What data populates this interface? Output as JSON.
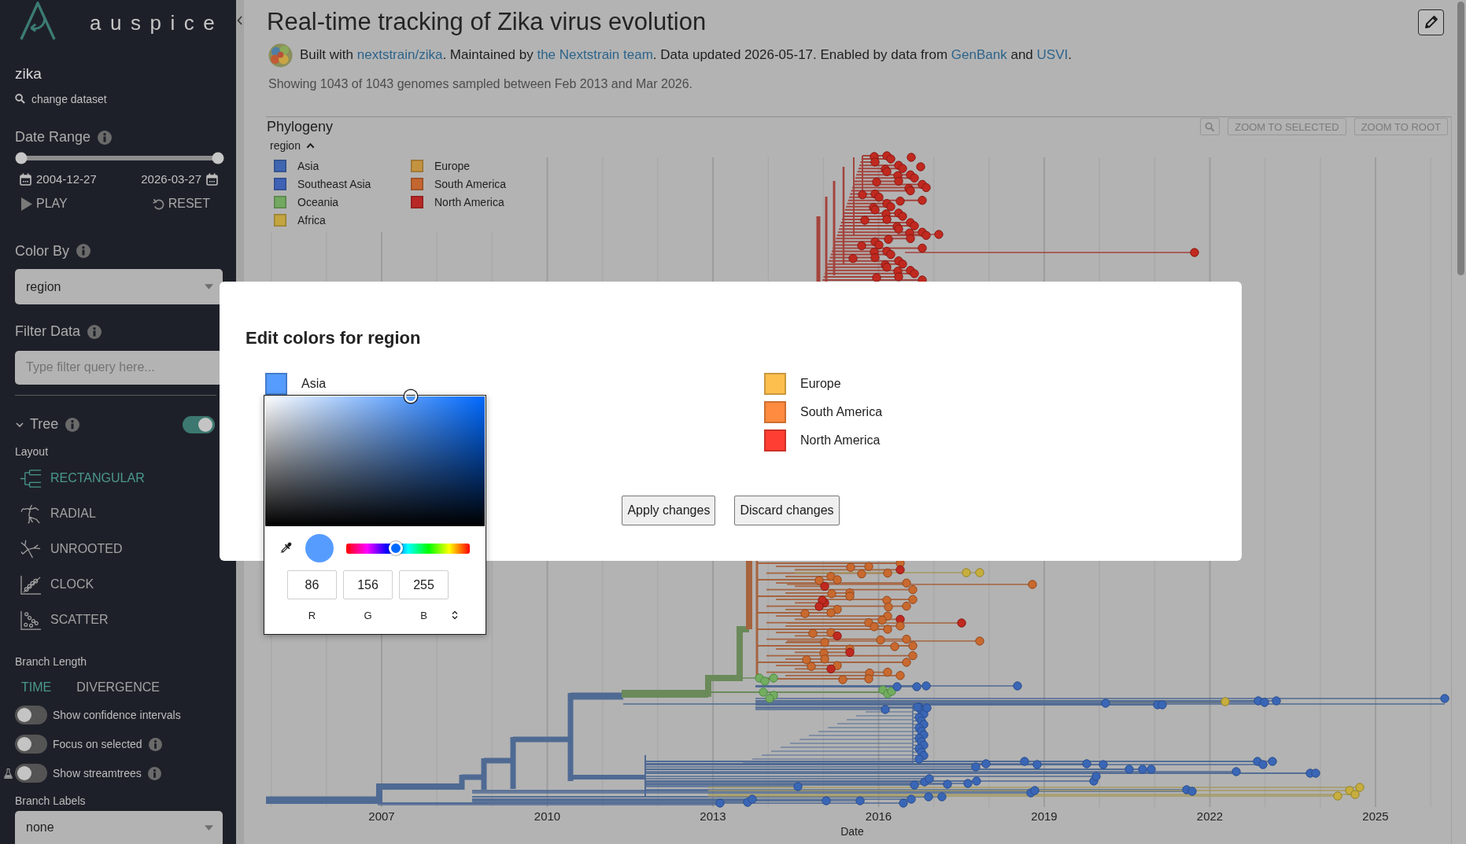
{
  "sidebar": {
    "logo_text": "auspice",
    "dataset": "zika",
    "change_dataset": "change dataset",
    "date_range": {
      "title": "Date Range",
      "level": 1,
      "start": "2004-12-27",
      "end": "2026-03-27",
      "play": "PLAY",
      "reset": "RESET"
    },
    "color_by": {
      "title": "Color By",
      "value": "region"
    },
    "filter": {
      "title": "Filter Data",
      "placeholder": "Type filter query here..."
    },
    "tree": {
      "title": "Tree",
      "expanded": true,
      "on": true,
      "layout_title": "Layout",
      "layouts": [
        {
          "kind": "rectangular",
          "label": "RECTANGULAR",
          "selected": true
        },
        {
          "kind": "radial",
          "label": "RADIAL",
          "selected": false
        },
        {
          "kind": "unrooted",
          "label": "UNROOTED",
          "selected": false
        },
        {
          "kind": "clock",
          "label": "CLOCK",
          "selected": false
        },
        {
          "kind": "scatter",
          "label": "SCATTER",
          "selected": false
        }
      ],
      "branch_length_title": "Branch Length",
      "branch_lengths": [
        {
          "label": "TIME",
          "selected": true
        },
        {
          "label": "DIVERGENCE",
          "selected": false
        }
      ],
      "toggles": [
        {
          "label": "Show confidence intervals",
          "on": false,
          "info": false,
          "experimental": false
        },
        {
          "label": "Focus on selected",
          "on": false,
          "info": true,
          "experimental": false
        },
        {
          "label": "Show streamtrees",
          "on": false,
          "info": true,
          "experimental": true
        }
      ],
      "branch_labels": {
        "title": "Branch Labels",
        "value": "none"
      }
    }
  },
  "header": {
    "title": "Real-time tracking of Zika virus evolution",
    "byline": [
      {
        "kind": "text",
        "text": "Built with "
      },
      {
        "kind": "link",
        "text": "nextstrain/zika"
      },
      {
        "kind": "text",
        "text": ". Maintained by "
      },
      {
        "kind": "link",
        "text": "the Nextstrain team"
      },
      {
        "kind": "text",
        "text": ". Data updated 2026-05-17. Enabled by data from "
      },
      {
        "kind": "link",
        "text": "GenBank"
      },
      {
        "kind": "text",
        "text": " and "
      },
      {
        "kind": "link",
        "text": "USVI"
      },
      {
        "kind": "text",
        "text": "."
      }
    ],
    "summary": "Showing 1043 of 1043 genomes sampled between Feb 2013 and Mar 2026."
  },
  "phylogeny": {
    "title": "Phylogeny",
    "buttons": [
      "ZOOM TO SELECTED",
      "ZOOM TO ROOT"
    ],
    "legend": {
      "title": "region",
      "expanded": true,
      "items": [
        {
          "label": "Asia",
          "color": "#3f66b0"
        },
        {
          "label": "Southeast Asia",
          "color": "#3f62b5"
        },
        {
          "label": "Oceania",
          "color": "#72a85f"
        },
        {
          "label": "Africa",
          "color": "#c3a53f"
        },
        {
          "label": "Europe",
          "color": "#c49340"
        },
        {
          "label": "South America",
          "color": "#c36630"
        },
        {
          "label": "North America",
          "color": "#b82826"
        }
      ]
    },
    "x_axis": {
      "ticks": [
        "2007",
        "2010",
        "2013",
        "2016",
        "2019",
        "2022",
        "2025"
      ],
      "label": "Date"
    }
  },
  "modal": {
    "title": "Edit colors for region",
    "columns": [
      {
        "items": [
          {
            "label": "Asia",
            "color": "#569cff"
          }
        ]
      },
      {
        "items": [
          {
            "label": "Europe",
            "color": "#fdbf4d"
          },
          {
            "label": "South America",
            "color": "#fe8b3f"
          },
          {
            "label": "North America",
            "color": "#ff3e33"
          }
        ]
      }
    ],
    "picker": {
      "level": 0.4,
      "channels": [
        {
          "label": "R",
          "value": "86"
        },
        {
          "label": "G",
          "value": "156"
        },
        {
          "label": "B",
          "value": "255"
        }
      ]
    },
    "buttons": [
      "Apply changes",
      "Discard changes"
    ]
  }
}
